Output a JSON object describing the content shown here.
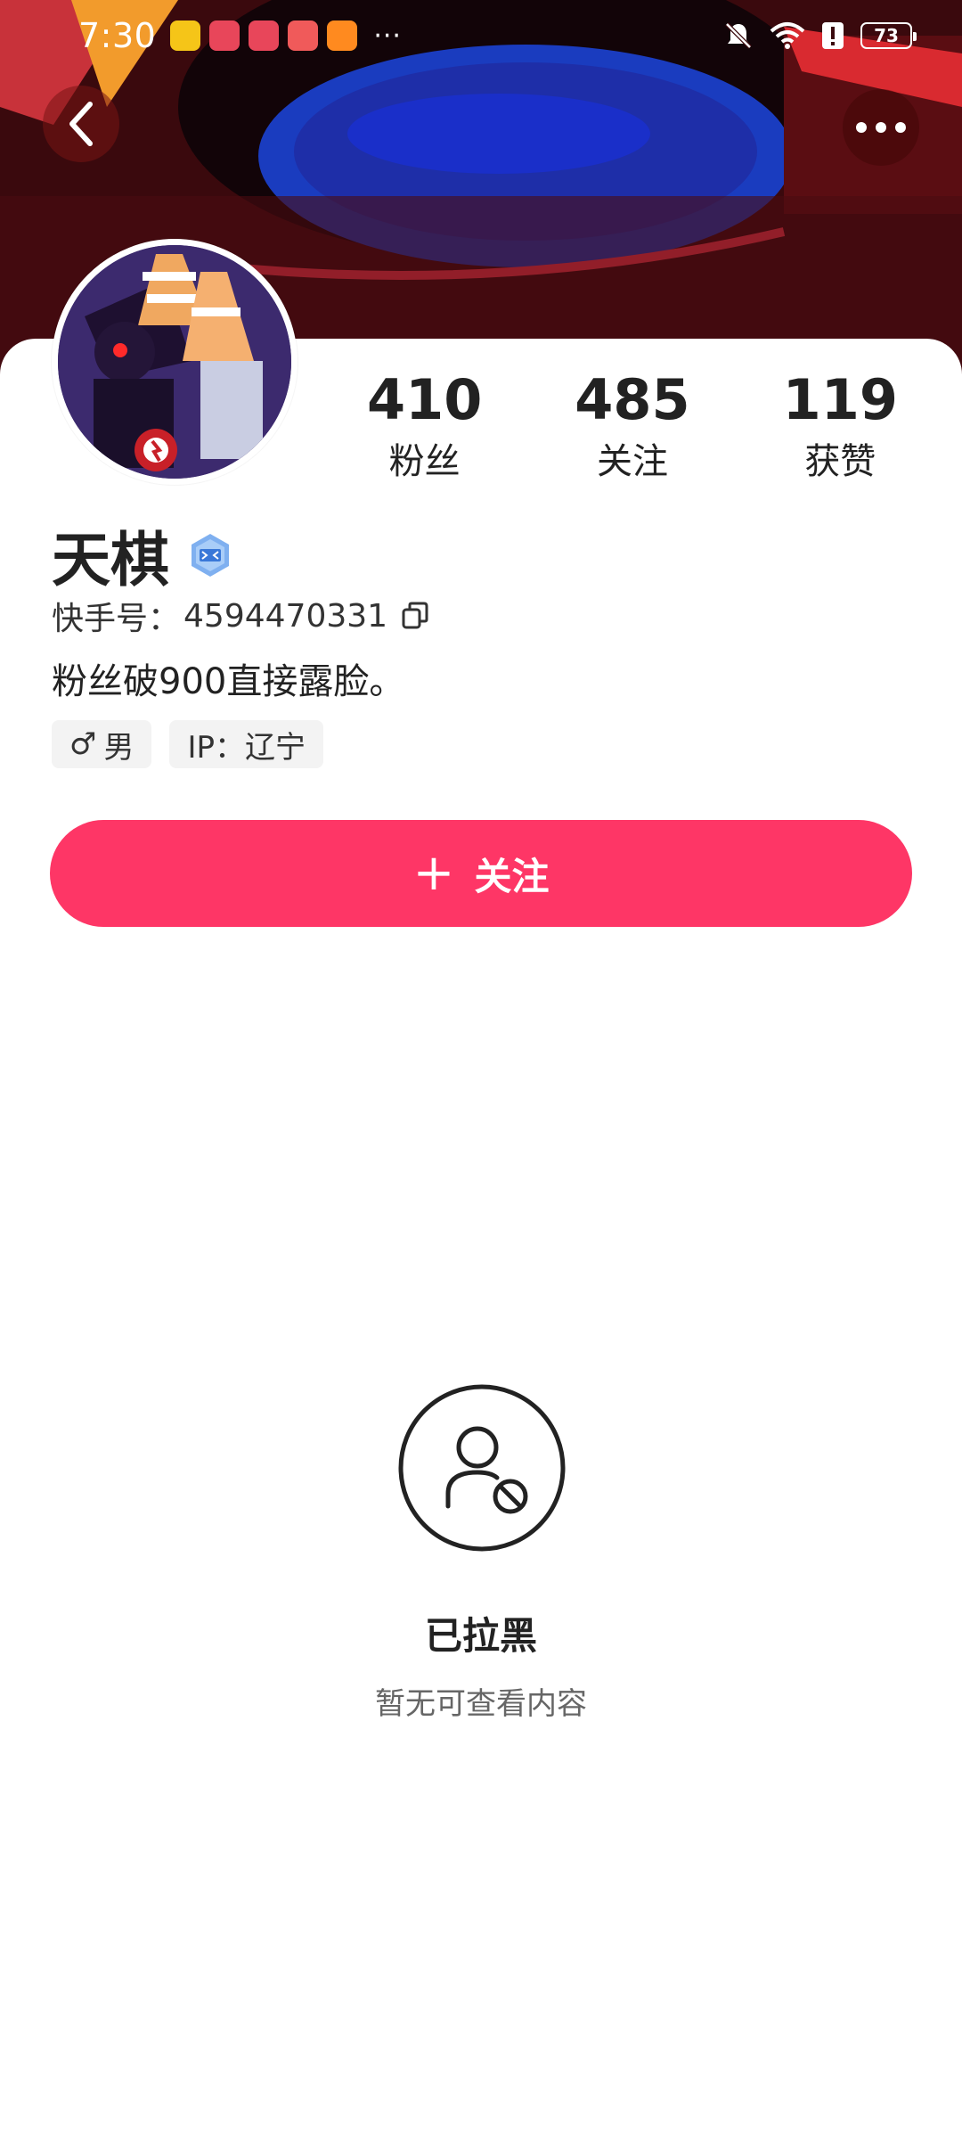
{
  "status_bar": {
    "time": "7:30",
    "more": "···",
    "battery": "73",
    "icons": [
      "weibo-icon",
      "app-icon",
      "app-icon",
      "huawei-icon",
      "video-icon",
      "bell-muted-icon",
      "wifi-icon",
      "alert-icon",
      "battery-icon"
    ]
  },
  "top_bar": {
    "back_icon": "chevron-left-icon",
    "more_icon": "more-dots-icon"
  },
  "profile": {
    "name": "天棋",
    "id_label": "快手号：",
    "id_value": "4594470331",
    "bio": "粉丝破900直接露脸。",
    "gender_symbol": "♂",
    "gender": "男",
    "ip": "IP：辽宁"
  },
  "stats": [
    {
      "value": "410",
      "label": "粉丝"
    },
    {
      "value": "485",
      "label": "关注"
    },
    {
      "value": "119",
      "label": "获赞"
    }
  ],
  "follow_button": {
    "plus": "+",
    "label": "关注"
  },
  "blocked": {
    "title": "已拉黑",
    "subtitle": "暂无可查看内容"
  },
  "colors": {
    "accent": "#fe3666",
    "banner": "#4a0d12"
  }
}
